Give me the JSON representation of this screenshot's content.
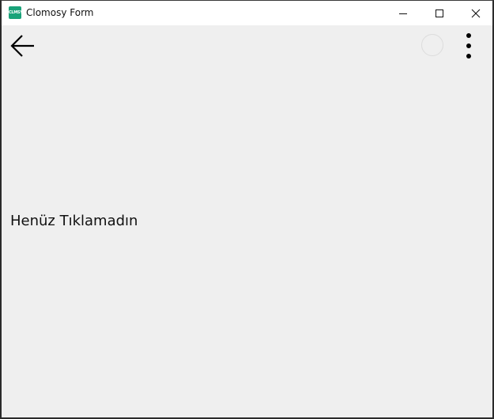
{
  "window": {
    "title": "Clomosy Form",
    "icon": "clomosy-app-icon",
    "icon_text": "CLMSY",
    "controls": [
      "minimize-icon",
      "maximize-icon",
      "close-icon"
    ]
  },
  "toolbar": {
    "back_icon": "arrow-left-icon",
    "progress_icon": "circle-outline-icon",
    "menu_icon": "more-vertical-icon"
  },
  "main": {
    "status_text": "Henüz Tıklamadın"
  },
  "colors": {
    "titlebar_bg": "#ffffff",
    "content_bg": "#efefef",
    "app_icon": "#1aa37a",
    "window_border": "#2b2b2b"
  }
}
